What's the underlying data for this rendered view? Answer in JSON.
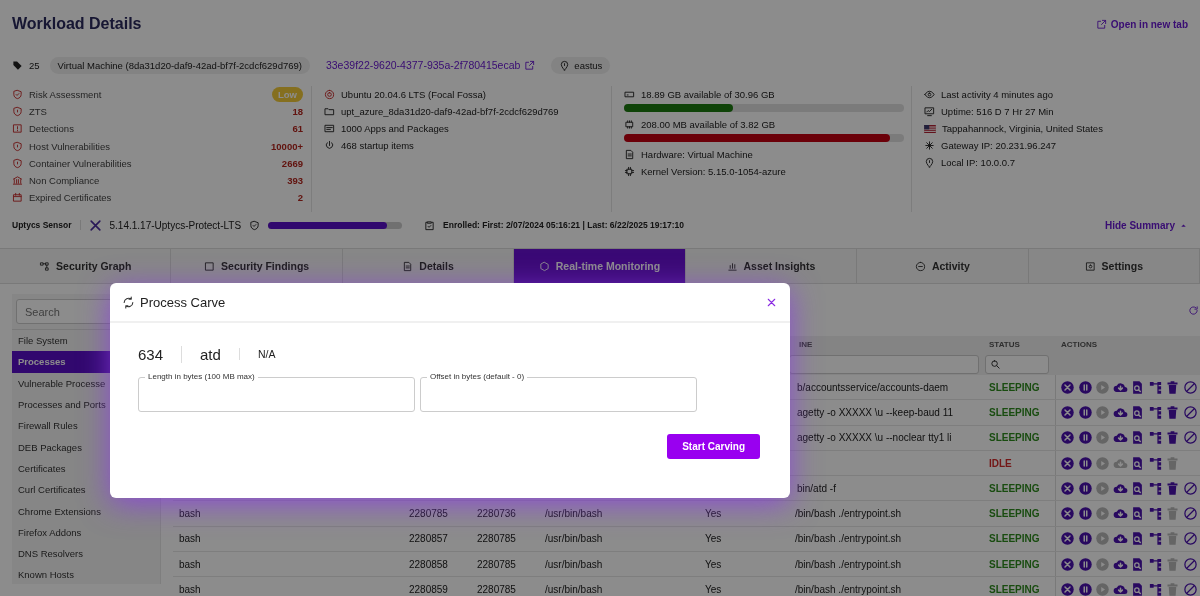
{
  "page": {
    "title": "Workload Details",
    "open_link": "Open in new tab"
  },
  "identity": {
    "tag_count": "25",
    "type_chip": "Virtual Machine (8da31d20-daf9-42ad-bf7f-2cdcf629d769)",
    "instance_link": "33e39f22-9620-4377-935a-2f780415ecab",
    "region": "eastus"
  },
  "metrics": [
    {
      "label": "Risk Assessment",
      "value": "Low",
      "kind": "badge"
    },
    {
      "label": "ZTS",
      "value": "18",
      "kind": "count"
    },
    {
      "label": "Detections",
      "value": "61",
      "kind": "count"
    },
    {
      "label": "Host Vulnerabilities",
      "value": "10000+",
      "kind": "count"
    },
    {
      "label": "Container Vulnerabilities",
      "value": "2669",
      "kind": "count"
    },
    {
      "label": "Non Compliance",
      "value": "393",
      "kind": "count"
    },
    {
      "label": "Expired Certificates",
      "value": "2",
      "kind": "count"
    }
  ],
  "system": [
    "Ubuntu 20.04.6 LTS (Focal Fossa)",
    "upt_azure_8da31d20-daf9-42ad-bf7f-2cdcf629d769",
    "1000 Apps and Packages",
    "468 startup items"
  ],
  "resources": [
    {
      "text": "18.89 GB available of 30.96 GB",
      "level": 0.39,
      "kind": "ok"
    },
    {
      "text": "208.00 MB available of 3.82 GB",
      "level": 0.95,
      "kind": "critical"
    }
  ],
  "hardware": [
    "Hardware: Virtual Machine",
    "Kernel Version: 5.15.0-1054-azure"
  ],
  "activity": [
    "Last activity 4 minutes ago",
    "Uptime: 516 D 7 Hr 27 Min",
    "Tappahannock, Virginia, United States",
    "Gateway IP: 20.231.96.247",
    "Local IP: 10.0.0.7"
  ],
  "sensor": {
    "label": "Uptycs Sensor",
    "version": "5.14.1.17-Uptycs-Protect-LTS",
    "level": 0.89,
    "enrolled": "Enrolled: First: 2/07/2024 05:16:21 | Last: 6/22/2025 19:17:10",
    "toggle": "Hide Summary"
  },
  "tabs": [
    {
      "label": "Security Graph",
      "selected": false
    },
    {
      "label": "Security Findings",
      "selected": false
    },
    {
      "label": "Details",
      "selected": false
    },
    {
      "label": "Real-time Monitoring",
      "selected": true
    },
    {
      "label": "Asset Insights",
      "selected": false
    },
    {
      "label": "Activity",
      "selected": false
    },
    {
      "label": "Settings",
      "selected": false
    }
  ],
  "sidebar": {
    "search_placeholder": "Search",
    "items": [
      {
        "label": "File System",
        "selected": false
      },
      {
        "label": "Processes",
        "selected": true
      },
      {
        "label": "Vulnerable Processe",
        "selected": false
      },
      {
        "label": "Processes and Ports",
        "selected": false
      },
      {
        "label": "Firewall Rules",
        "selected": false
      },
      {
        "label": "DEB Packages",
        "selected": false
      },
      {
        "label": "Certificates",
        "selected": false
      },
      {
        "label": "Curl Certificates",
        "selected": false
      },
      {
        "label": "Chrome Extensions",
        "selected": false
      },
      {
        "label": "Firefox Addons",
        "selected": false
      },
      {
        "label": "DNS Resolvers",
        "selected": false
      },
      {
        "label": "Known Hosts",
        "selected": false
      }
    ]
  },
  "table": {
    "headers": {
      "column_6": "INE",
      "status": "STATUS",
      "actions": "ACTIONS"
    },
    "rows": [
      {
        "column_6": "b/accountsservice/accounts-daem",
        "status": {
          "text": "SLEEPING",
          "kind": "ok"
        },
        "actions": [
          {
            "kind": "kill",
            "disabled": false
          },
          {
            "kind": "pause",
            "disabled": false
          },
          {
            "kind": "resume",
            "disabled": true
          },
          {
            "kind": "download",
            "disabled": false
          },
          {
            "kind": "inspect",
            "disabled": false
          },
          {
            "kind": "tree",
            "disabled": false
          },
          {
            "kind": "delete",
            "disabled": false
          },
          {
            "kind": "block",
            "disabled": false
          }
        ]
      },
      {
        "column_6": "agetty -o XXXXX \\u --keep-baud 11",
        "status": {
          "text": "SLEEPING",
          "kind": "ok"
        },
        "actions": [
          {
            "kind": "kill",
            "disabled": false
          },
          {
            "kind": "pause",
            "disabled": false
          },
          {
            "kind": "resume",
            "disabled": true
          },
          {
            "kind": "download",
            "disabled": false
          },
          {
            "kind": "inspect",
            "disabled": false
          },
          {
            "kind": "tree",
            "disabled": false
          },
          {
            "kind": "delete",
            "disabled": false
          },
          {
            "kind": "block",
            "disabled": false
          }
        ]
      },
      {
        "column_6": "agetty -o XXXXX \\u --noclear tty1 li",
        "status": {
          "text": "SLEEPING",
          "kind": "ok"
        },
        "actions": [
          {
            "kind": "kill",
            "disabled": false
          },
          {
            "kind": "pause",
            "disabled": false
          },
          {
            "kind": "resume",
            "disabled": true
          },
          {
            "kind": "download",
            "disabled": false
          },
          {
            "kind": "inspect",
            "disabled": false
          },
          {
            "kind": "tree",
            "disabled": false
          },
          {
            "kind": "delete",
            "disabled": false
          },
          {
            "kind": "block",
            "disabled": false
          }
        ]
      },
      {
        "status": {
          "text": "IDLE",
          "kind": "alert"
        },
        "actions": [
          {
            "kind": "kill",
            "disabled": false
          },
          {
            "kind": "pause",
            "disabled": false
          },
          {
            "kind": "resume",
            "disabled": true
          },
          {
            "kind": "download",
            "disabled": true
          },
          {
            "kind": "inspect",
            "disabled": false
          },
          {
            "kind": "tree",
            "disabled": false
          },
          {
            "kind": "delete",
            "disabled": true
          }
        ]
      },
      {
        "column_6": "bin/atd -f",
        "status": {
          "text": "SLEEPING",
          "kind": "ok"
        },
        "actions": [
          {
            "kind": "kill",
            "disabled": false
          },
          {
            "kind": "pause",
            "disabled": false
          },
          {
            "kind": "resume",
            "disabled": true
          },
          {
            "kind": "download",
            "disabled": false
          },
          {
            "kind": "inspect",
            "disabled": false
          },
          {
            "kind": "tree",
            "disabled": false
          },
          {
            "kind": "delete",
            "disabled": false
          },
          {
            "kind": "block",
            "disabled": false
          }
        ]
      },
      {
        "column_1": "bash",
        "column_2": "2280785",
        "column_3": "2280736",
        "column_4": "/usr/bin/bash",
        "column_5": "Yes",
        "column_6": "/bin/bash ./entrypoint.sh",
        "status": {
          "text": "SLEEPING",
          "kind": "ok"
        },
        "actions": [
          {
            "kind": "kill",
            "disabled": false
          },
          {
            "kind": "pause",
            "disabled": false
          },
          {
            "kind": "resume",
            "disabled": true
          },
          {
            "kind": "download",
            "disabled": false
          },
          {
            "kind": "inspect",
            "disabled": false
          },
          {
            "kind": "tree",
            "disabled": false
          },
          {
            "kind": "delete",
            "disabled": true
          },
          {
            "kind": "block",
            "disabled": false
          }
        ]
      },
      {
        "column_1": "bash",
        "column_2": "2280857",
        "column_3": "2280785",
        "column_4": "/usr/bin/bash",
        "column_5": "Yes",
        "column_6": "/bin/bash ./entrypoint.sh",
        "status": {
          "text": "SLEEPING",
          "kind": "ok"
        },
        "actions": [
          {
            "kind": "kill",
            "disabled": false
          },
          {
            "kind": "pause",
            "disabled": false
          },
          {
            "kind": "resume",
            "disabled": true
          },
          {
            "kind": "download",
            "disabled": false
          },
          {
            "kind": "inspect",
            "disabled": false
          },
          {
            "kind": "tree",
            "disabled": false
          },
          {
            "kind": "delete",
            "disabled": true
          },
          {
            "kind": "block",
            "disabled": false
          }
        ]
      },
      {
        "column_1": "bash",
        "column_2": "2280858",
        "column_3": "2280785",
        "column_4": "/usr/bin/bash",
        "column_5": "Yes",
        "column_6": "/bin/bash ./entrypoint.sh",
        "status": {
          "text": "SLEEPING",
          "kind": "ok"
        },
        "actions": [
          {
            "kind": "kill",
            "disabled": false
          },
          {
            "kind": "pause",
            "disabled": false
          },
          {
            "kind": "resume",
            "disabled": true
          },
          {
            "kind": "download",
            "disabled": false
          },
          {
            "kind": "inspect",
            "disabled": false
          },
          {
            "kind": "tree",
            "disabled": false
          },
          {
            "kind": "delete",
            "disabled": true
          },
          {
            "kind": "block",
            "disabled": false
          }
        ]
      },
      {
        "column_1": "bash",
        "column_2": "2280859",
        "column_3": "2280785",
        "column_4": "/usr/bin/bash",
        "column_5": "Yes",
        "column_6": "/bin/bash ./entrypoint.sh",
        "status": {
          "text": "SLEEPING",
          "kind": "ok"
        },
        "actions": [
          {
            "kind": "kill",
            "disabled": false
          },
          {
            "kind": "pause",
            "disabled": false
          },
          {
            "kind": "resume",
            "disabled": true
          },
          {
            "kind": "download",
            "disabled": false
          },
          {
            "kind": "inspect",
            "disabled": false
          },
          {
            "kind": "tree",
            "disabled": false
          },
          {
            "kind": "delete",
            "disabled": true
          },
          {
            "kind": "block",
            "disabled": false
          }
        ]
      }
    ]
  },
  "modal": {
    "title": "Process Carve",
    "column_1": "634",
    "column_2": "atd",
    "column_3": "N/A",
    "fields": [
      {
        "label": "Length in bytes (100 MB max)"
      },
      {
        "label": "Offset in bytes (default - 0)"
      }
    ],
    "button": "Start Carving"
  }
}
